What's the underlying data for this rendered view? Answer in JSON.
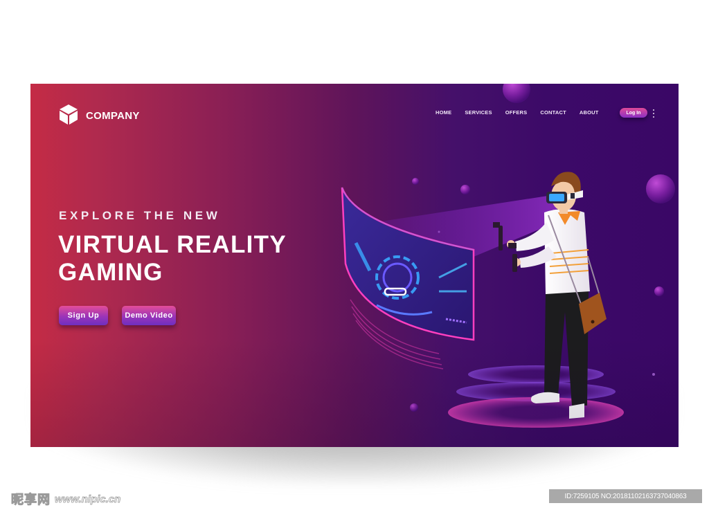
{
  "header": {
    "brand": "COMPANY",
    "brand_icon": "cube-icon",
    "nav": [
      {
        "label": "HOME"
      },
      {
        "label": "SERVICES"
      },
      {
        "label": "OFFERS"
      },
      {
        "label": "CONTACT"
      },
      {
        "label": "ABOUT"
      }
    ],
    "login_label": "Log In",
    "more_icon": "kebab-menu-icon"
  },
  "hero": {
    "eyebrow": "EXPLORE THE NEW",
    "title_line1": "VIRTUAL REALITY",
    "title_line2": "GAMING",
    "primary_button": "Sign Up",
    "secondary_button": "Demo Video"
  },
  "illustration": {
    "subject": "man-wearing-vr-headset",
    "screen": "curved-holographic-display"
  },
  "colors": {
    "gradient_start": "#c42b45",
    "gradient_mid": "#5e145a",
    "gradient_end": "#3a0766",
    "button_top": "#e44d98",
    "button_bottom": "#6e2fc0",
    "neon_pink": "#ff3fbf",
    "screen_blue": "#3aa8ff"
  },
  "watermark": {
    "site_cn": "昵享网",
    "site_url": "www.nipic.cn",
    "id_text": "ID:7259105 NO:20181102163737040863"
  }
}
